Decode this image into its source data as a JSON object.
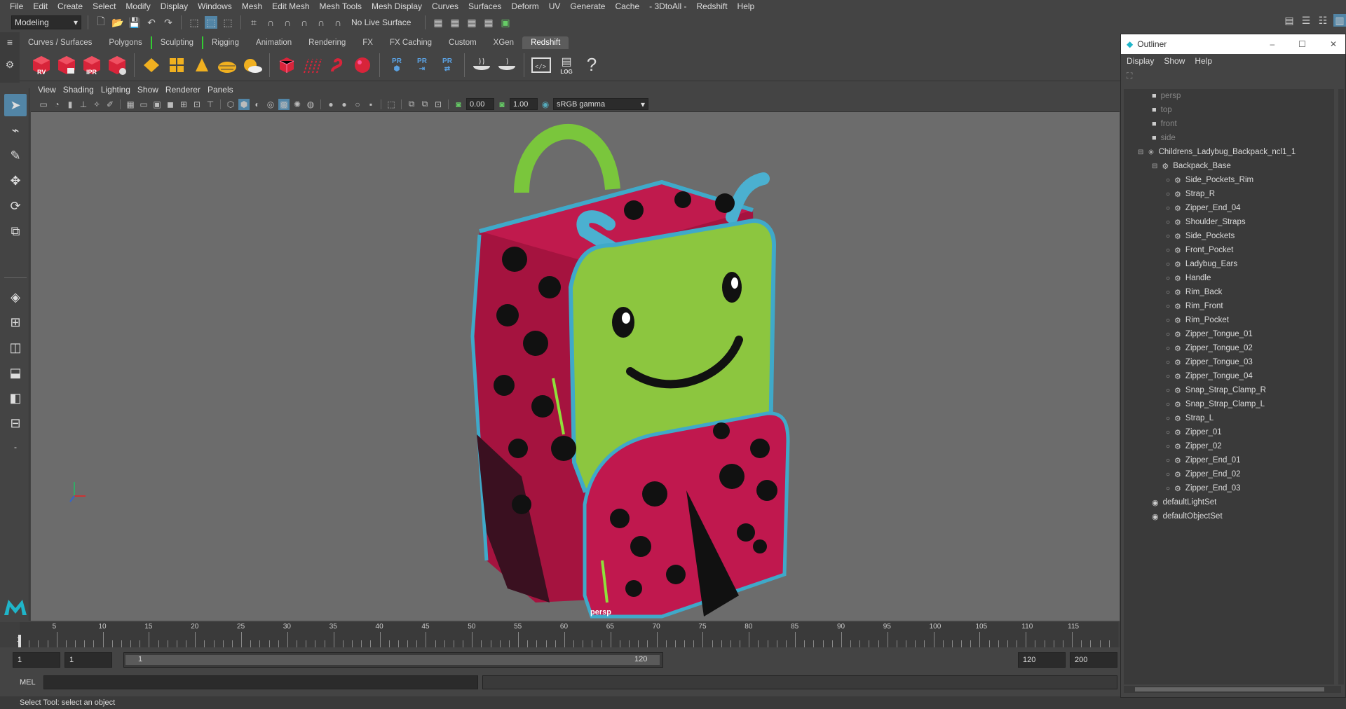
{
  "menubar": [
    "File",
    "Edit",
    "Create",
    "Select",
    "Modify",
    "Display",
    "Windows",
    "Mesh",
    "Edit Mesh",
    "Mesh Tools",
    "Mesh Display",
    "Curves",
    "Surfaces",
    "Deform",
    "UV",
    "Generate",
    "Cache",
    "- 3DtoAll -",
    "Redshift",
    "Help"
  ],
  "statusline": {
    "mode": "Modeling",
    "live_surface": "No Live Surface"
  },
  "shelf_tabs": [
    "Curves / Surfaces",
    "Polygons",
    "Sculpting",
    "Rigging",
    "Animation",
    "Rendering",
    "FX",
    "FX Caching",
    "Custom",
    "XGen",
    "Redshift"
  ],
  "shelf_active": "Redshift",
  "shelf_labels": {
    "rv": "RV",
    "ipr": "IPR",
    "pr1": "PR",
    "pr2": "PR",
    "pr3": "PR",
    "log": "LOG",
    "help": "?"
  },
  "viewport_menu": [
    "View",
    "Shading",
    "Lighting",
    "Show",
    "Renderer",
    "Panels"
  ],
  "viewport_toolbar": {
    "exposure": "0.00",
    "gamma": "1.00",
    "color_space": "sRGB gamma"
  },
  "viewport": {
    "camera_label": "persp"
  },
  "timeline": {
    "ticks": [
      "1",
      "5",
      "10",
      "15",
      "20",
      "25",
      "30",
      "35",
      "40",
      "45",
      "50",
      "55",
      "60",
      "65",
      "70",
      "75",
      "80",
      "85",
      "90",
      "95",
      "100",
      "105",
      "110",
      "115"
    ],
    "current_frame": "1"
  },
  "range": {
    "start": "1",
    "playback_start": "1",
    "slider_start": "1",
    "slider_end": "120",
    "playback_end": "120",
    "end": "200"
  },
  "mel": {
    "label": "MEL"
  },
  "helpline": "Select Tool: select an object",
  "outliner": {
    "title": "Outliner",
    "menu": [
      "Display",
      "Show",
      "Help"
    ],
    "cameras": [
      "persp",
      "top",
      "front",
      "side"
    ],
    "root": "Childrens_Ladybug_Backpack_ncl1_1",
    "group": "Backpack_Base",
    "children": [
      "Side_Pockets_Rim",
      "Strap_R",
      "Zipper_End_04",
      "Shoulder_Straps",
      "Side_Pockets",
      "Front_Pocket",
      "Ladybug_Ears",
      "Handle",
      "Rim_Back",
      "Rim_Front",
      "Rim_Pocket",
      "Zipper_Tongue_01",
      "Zipper_Tongue_02",
      "Zipper_Tongue_03",
      "Zipper_Tongue_04",
      "Snap_Strap_Clamp_R",
      "Snap_Strap_Clamp_L",
      "Strap_L",
      "Zipper_01",
      "Zipper_02",
      "Zipper_End_01",
      "Zipper_End_02",
      "Zipper_End_03"
    ],
    "sets": [
      "defaultLightSet",
      "defaultObjectSet"
    ]
  },
  "colors": {
    "accent": "#5285a6",
    "viewport_bg": "#6c6c6c",
    "panel": "#444444",
    "ladybug_red": "#b0164a",
    "face_green": "#8cc63f",
    "rim_blue": "#3fa9c9"
  }
}
